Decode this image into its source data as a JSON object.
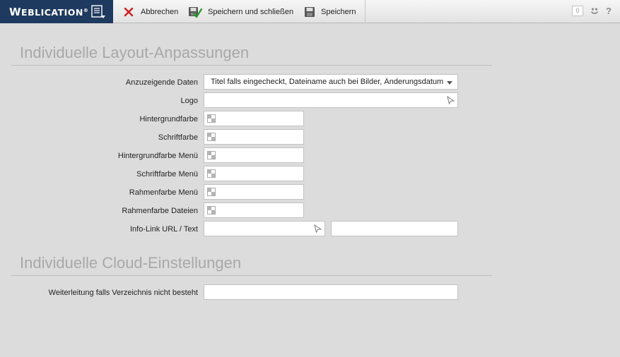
{
  "toolbar": {
    "brand": "Weblication",
    "brand_first": "W",
    "brand_rest": "EBLICATION",
    "brand_mark": "®",
    "cancel_label": "Abbrechen",
    "save_close_label": "Speichern und schließen",
    "save_label": "Speichern",
    "notification_count": "0",
    "help_label": "?"
  },
  "colors": {
    "brand_bg": "#1f3a5f",
    "cancel_icon": "#cc1f1f",
    "section_title": "#a8a8a8"
  },
  "layout_section": {
    "title": "Individuelle Layout-Anpassungen",
    "fields": {
      "display_data_label": "Anzuzeigende Daten",
      "display_data_value": "Titel falls eingecheckt, Dateiname auch bei Bilder, Änderungsdatum, I",
      "logo_label": "Logo",
      "bg_color_label": "Hintergrundfarbe",
      "font_color_label": "Schriftfarbe",
      "bg_color_menu_label": "Hintergrundfarbe Menü",
      "font_color_menu_label": "Schriftfarbe Menü",
      "border_color_menu_label": "Rahmenfarbe Menü",
      "border_color_files_label": "Rahmenfarbe Dateien",
      "info_link_label": "Info-Link URL / Text"
    }
  },
  "cloud_section": {
    "title": "Individuelle Cloud-Einstellungen",
    "redirect_label": "Weiterleitung falls Verzeichnis nicht besteht"
  }
}
